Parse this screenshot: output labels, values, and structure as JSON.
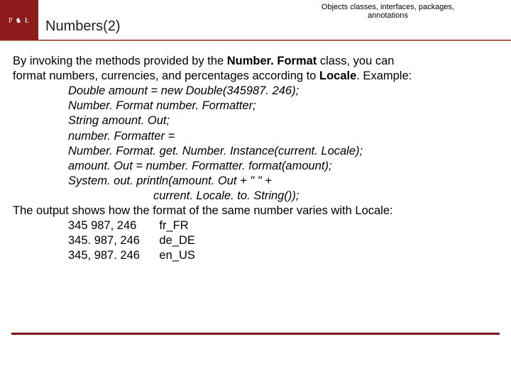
{
  "header": {
    "topic_line1": "Objects classes, interfaces, packages,",
    "topic_line2": "annotations",
    "title": "Numbers(2)",
    "logo_text": "P ♞ Ł"
  },
  "body": {
    "intro1a": "By invoking the methods provided by the ",
    "intro1b": "Number. Format",
    "intro1c": " class, you can",
    "intro2a": "format numbers, currencies, and percentages according to ",
    "intro2b": "Locale",
    "intro2c": ". Example:",
    "code": {
      "l1": "Double amount = new Double(345987. 246);",
      "l2": "Number. Format number. Formatter;",
      "l3": "String amount. Out;",
      "l4": "number. Formatter =",
      "l5": "Number. Format. get. Number. Instance(current. Locale);",
      "l6": "amount. Out = number. Formatter. format(amount);",
      "l7": "System. out. println(amount. Out + \" \" +",
      "l8": "current. Locale. to. String());"
    },
    "outro": "The output  shows how the format of the same number varies with Locale:",
    "output": {
      "r1": "345 987, 246       fr_FR",
      "r2": "345. 987, 246      de_DE",
      "r3": "345, 987. 246      en_US"
    }
  }
}
